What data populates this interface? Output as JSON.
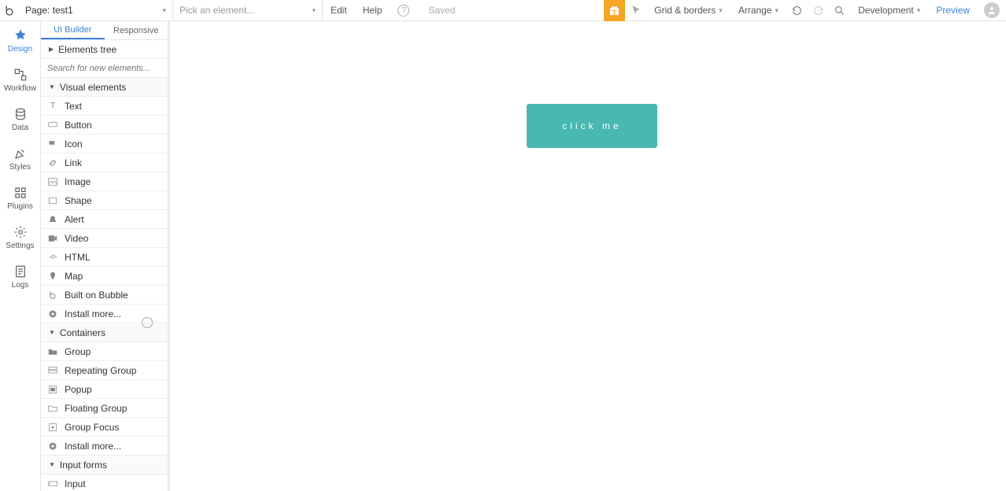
{
  "topbar": {
    "page_prefix": "Page: ",
    "page_name": "test1",
    "element_picker_placeholder": "Pick an element...",
    "edit": "Edit",
    "help": "Help",
    "saved": "Saved",
    "grid": "Grid & borders",
    "arrange": "Arrange",
    "env": "Development",
    "preview": "Preview"
  },
  "rail": {
    "design": "Design",
    "workflow": "Workflow",
    "data": "Data",
    "styles": "Styles",
    "plugins": "Plugins",
    "settings": "Settings",
    "logs": "Logs"
  },
  "panel": {
    "tab_ui": "UI Builder",
    "tab_resp": "Responsive",
    "elements_tree": "Elements tree",
    "search_placeholder": "Search for new elements...",
    "visual": "Visual elements",
    "containers": "Containers",
    "input_forms": "Input forms",
    "items_visual": {
      "text": "Text",
      "button": "Button",
      "icon": "Icon",
      "link": "Link",
      "image": "Image",
      "shape": "Shape",
      "alert": "Alert",
      "video": "Video",
      "html": "HTML",
      "map": "Map",
      "bob": "Built on Bubble",
      "install": "Install more..."
    },
    "items_containers": {
      "group": "Group",
      "rg": "Repeating Group",
      "popup": "Popup",
      "fg": "Floating Group",
      "gf": "Group Focus",
      "install": "Install more..."
    },
    "items_forms": {
      "input": "Input"
    }
  },
  "canvas": {
    "button_label": "click me"
  }
}
